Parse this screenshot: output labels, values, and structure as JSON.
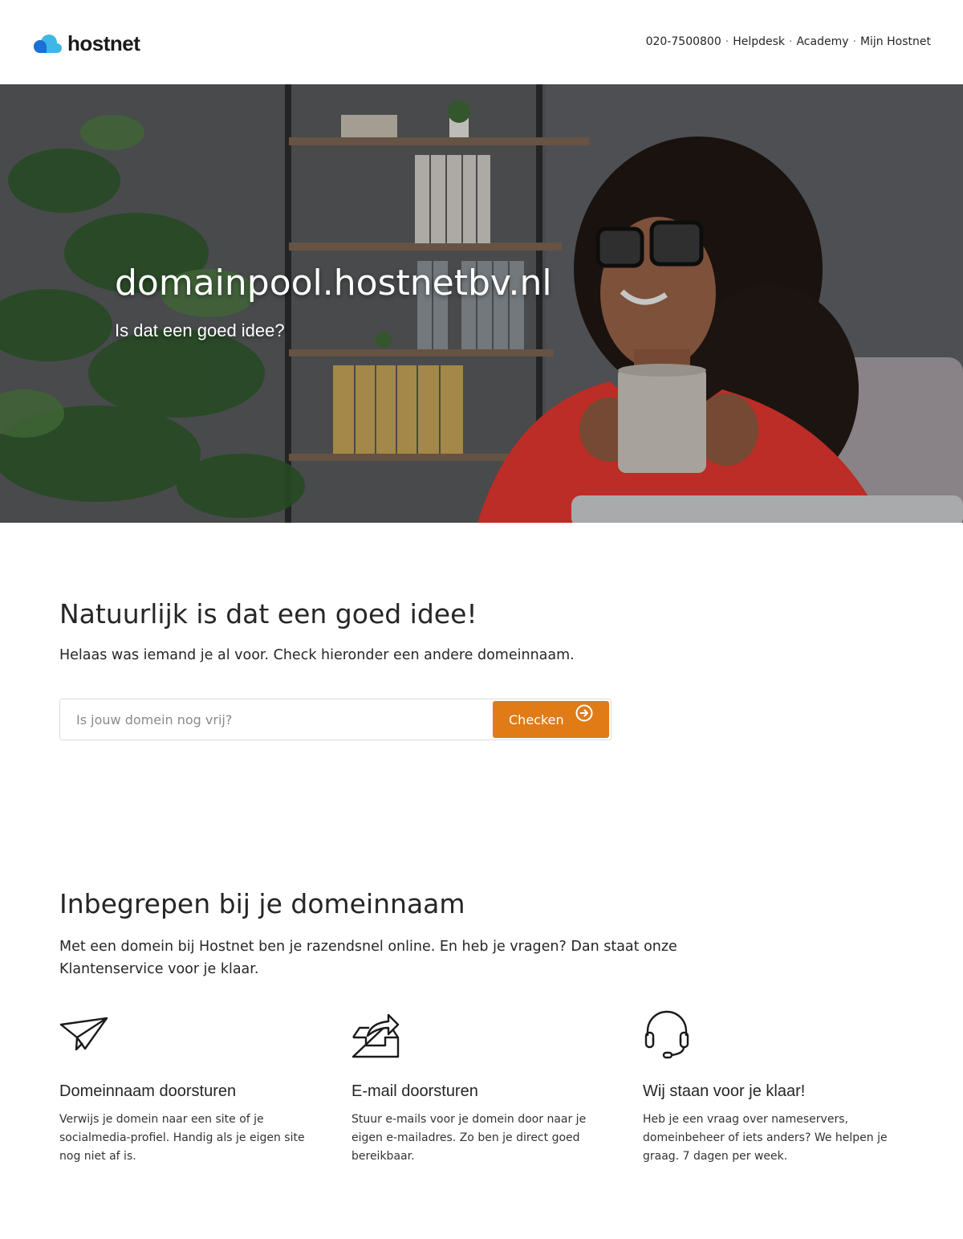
{
  "brand": {
    "name": "hostnet",
    "primary": "#1b6fd6",
    "accent": "#3fb7e5",
    "cta": "#e07b16"
  },
  "topnav": {
    "phone": "020-7500800",
    "separator": "·",
    "items": [
      "Helpdesk",
      "Academy",
      "Mijn Hostnet"
    ]
  },
  "hero": {
    "title": "domainpool.hostnetbv.nl",
    "subtitle": "Is dat een goed idee?",
    "image": "woman-with-coffee-in-office-photo"
  },
  "check": {
    "heading": "Natuurlijk is dat een goed idee!",
    "text": "Helaas was iemand je al voor. Check hieronder een andere domeinnaam.",
    "input_placeholder": "Is jouw domein nog vrij?",
    "input_value": "",
    "button_label": "Checken",
    "button_icon": "arrow-right-circle-icon"
  },
  "included": {
    "heading": "Inbegrepen bij je domeinnaam",
    "intro": "Met een domein bij Hostnet ben je razendsnel online. En heb je vragen? Dan staat onze Klantenservice voor je klaar.",
    "features": [
      {
        "icon": "paper-plane-icon",
        "title": "Domeinnaam doorsturen",
        "text": "Verwijs je domein naar een site of je socialmedia-profiel. Handig als je eigen site nog niet af is."
      },
      {
        "icon": "inbox-forward-icon",
        "title": "E-mail doorsturen",
        "text": "Stuur e-mails voor je domein door naar je eigen e-mailadres. Zo ben je direct goed bereikbaar."
      },
      {
        "icon": "headset-icon",
        "title": "Wij staan voor je klaar!",
        "text": "Heb je een vraag over nameservers, domeinbeheer of iets anders? We helpen je graag. 7 dagen per week."
      }
    ]
  }
}
